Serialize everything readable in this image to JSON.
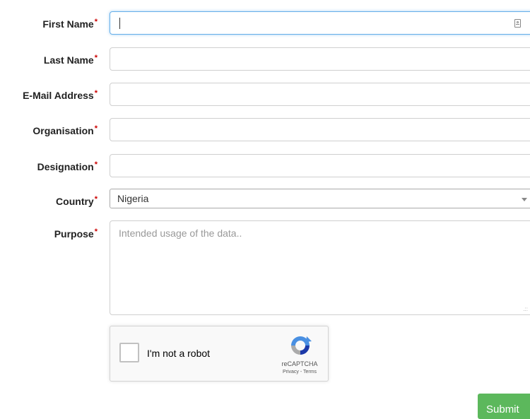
{
  "form": {
    "required_marker": "*",
    "fields": [
      {
        "label": "First Name",
        "value": ""
      },
      {
        "label": "Last Name",
        "value": ""
      },
      {
        "label": "E-Mail Address",
        "value": ""
      },
      {
        "label": "Organisation",
        "value": ""
      },
      {
        "label": "Designation",
        "value": ""
      }
    ],
    "country": {
      "label": "Country",
      "selected": "Nigeria"
    },
    "purpose": {
      "label": "Purpose",
      "placeholder": "Intended usage of the data.."
    }
  },
  "captcha": {
    "label": "I'm not a robot",
    "brand": "reCAPTCHA",
    "links": "Privacy - Terms"
  },
  "actions": {
    "submit_label": "Submit"
  },
  "colors": {
    "accent": "#5cb85c",
    "required": "#cc0000",
    "focus": "#66afe9"
  }
}
